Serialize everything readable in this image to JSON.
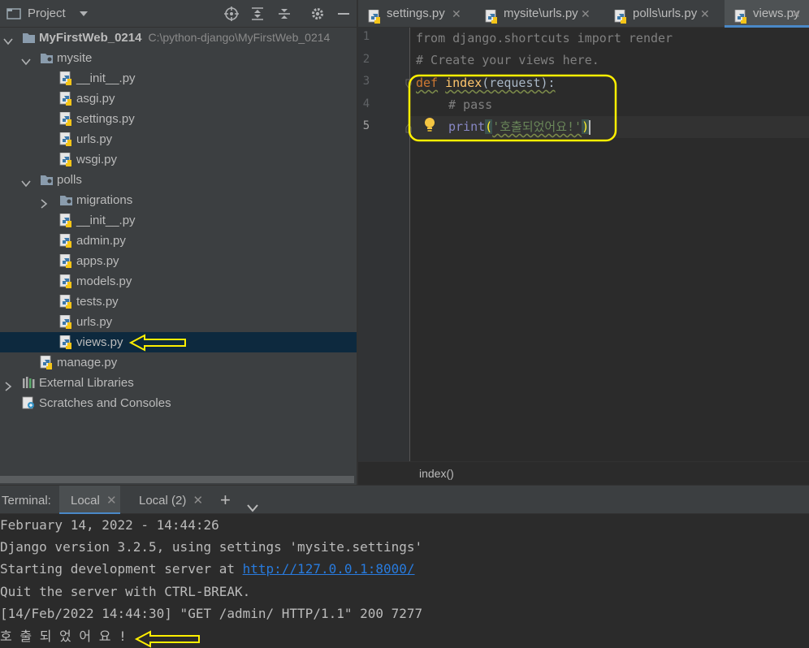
{
  "project_panel": {
    "title": "Project",
    "tree": [
      {
        "label": "MyFirstWeb_0214",
        "path": "C:\\python-django\\MyFirstWeb_0214",
        "kind": "root-folder",
        "expanded": true
      },
      {
        "label": "mysite",
        "kind": "folder",
        "expanded": true
      },
      {
        "label": "__init__.py",
        "kind": "py"
      },
      {
        "label": "asgi.py",
        "kind": "py"
      },
      {
        "label": "settings.py",
        "kind": "py"
      },
      {
        "label": "urls.py",
        "kind": "py"
      },
      {
        "label": "wsgi.py",
        "kind": "py"
      },
      {
        "label": "polls",
        "kind": "folder",
        "expanded": true
      },
      {
        "label": "migrations",
        "kind": "folder",
        "expanded": false
      },
      {
        "label": "__init__.py",
        "kind": "py"
      },
      {
        "label": "admin.py",
        "kind": "py"
      },
      {
        "label": "apps.py",
        "kind": "py"
      },
      {
        "label": "models.py",
        "kind": "py"
      },
      {
        "label": "tests.py",
        "kind": "py"
      },
      {
        "label": "urls.py",
        "kind": "py"
      },
      {
        "label": "views.py",
        "kind": "py",
        "selected": true
      },
      {
        "label": "manage.py",
        "kind": "py"
      },
      {
        "label": "External Libraries",
        "kind": "libraries",
        "expanded": false
      },
      {
        "label": "Scratches and Consoles",
        "kind": "scratches"
      }
    ]
  },
  "editor_tabs": [
    {
      "label": "settings.py",
      "active": false
    },
    {
      "label": "mysite\\urls.py",
      "active": false
    },
    {
      "label": "polls\\urls.py",
      "active": false
    },
    {
      "label": "views.py",
      "active": true
    }
  ],
  "editor": {
    "line_numbers": [
      "1",
      "2",
      "3",
      "4",
      "5"
    ],
    "lines": {
      "l1": "from django.shortcuts import render",
      "l2": "# Create your views here.",
      "l3_kw": "def",
      "l3_fn": "index",
      "l3_rest": "(request):",
      "l4": "# pass",
      "l5_fn": "print",
      "l5_open": "(",
      "l5_str": "'호출되었어요!'",
      "l5_close": ")"
    },
    "breadcrumb": "index()"
  },
  "terminal": {
    "label": "Terminal:",
    "tabs": [
      {
        "label": "Local",
        "active": true
      },
      {
        "label": "Local (2)",
        "active": false
      }
    ],
    "lines": [
      "February 14, 2022 - 14:44:26",
      "Django version 3.2.5, using settings 'mysite.settings'",
      "Quit the server with CTRL-BREAK.",
      "[14/Feb/2022 14:44:30] \"GET /admin/ HTTP/1.1\" 200 7277",
      "호 출 되 었 어 요 !"
    ],
    "server_prefix": "Starting development server at ",
    "server_url": "http://127.0.0.1:8000/"
  },
  "colors": {
    "annotation": "#ffef00",
    "selection": "#0d293e",
    "link": "#287bde",
    "active_tab_underline": "#4a88c7"
  }
}
